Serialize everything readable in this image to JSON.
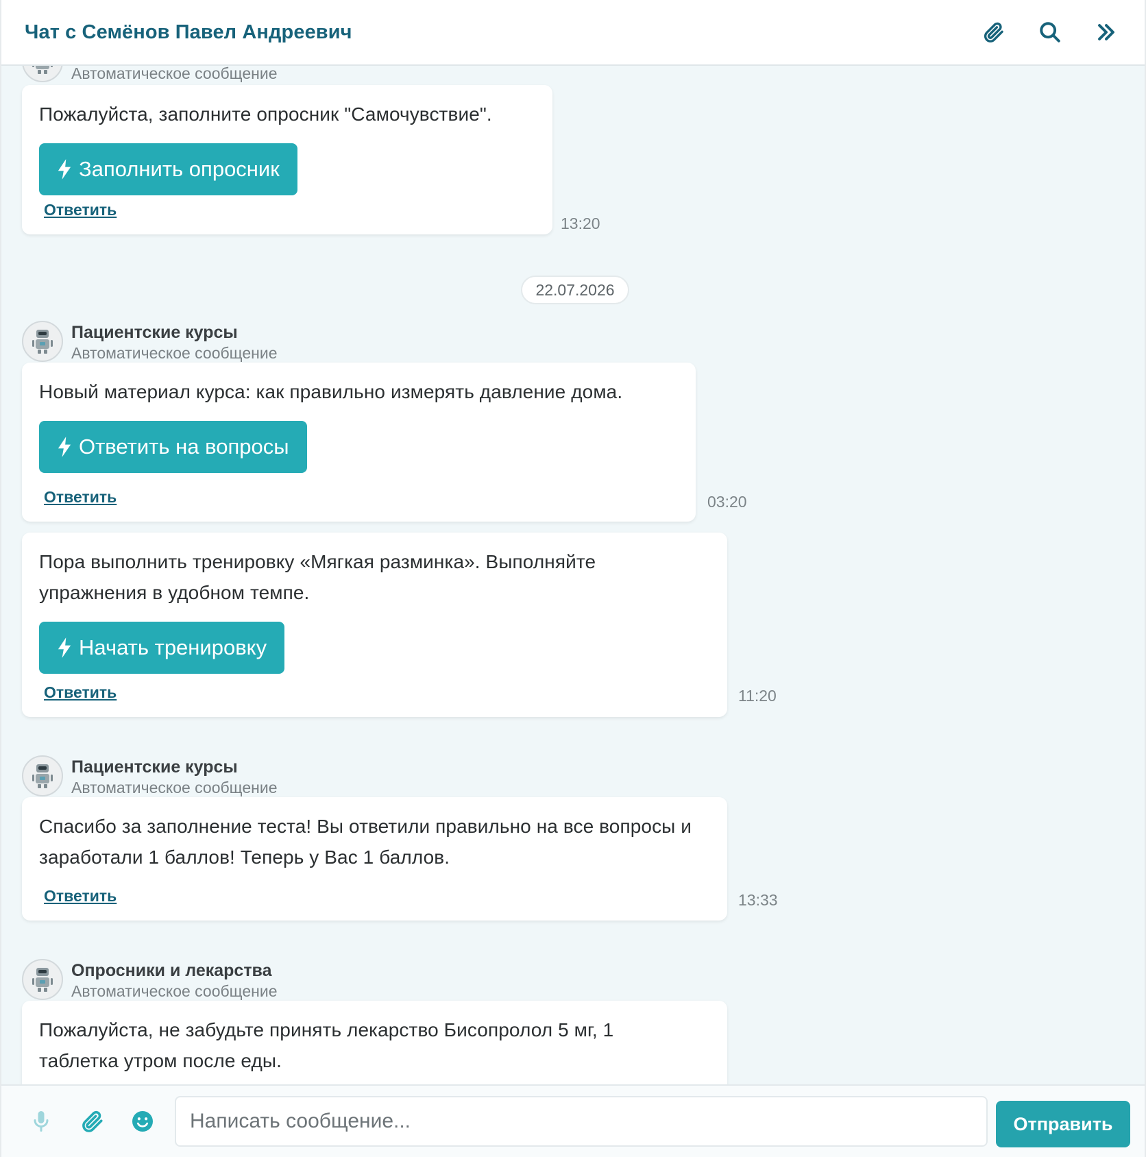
{
  "header": {
    "title": "Чат с Семёнов Павел Андреевич",
    "icons": [
      "paperclip-icon",
      "search-icon",
      "double-chevron-right-icon"
    ]
  },
  "colors": {
    "accent": "#25abb5",
    "title": "#17627a",
    "chat_bg": "#f0f7f9"
  },
  "chat": {
    "messages": [
      {
        "sender_sub": "Автоматическое сообщение",
        "text": "Пожалуйста, заполните опросник \"Самочувствие\".",
        "button": "Заполнить опросник",
        "reply": "Ответить",
        "time": "13:20"
      }
    ],
    "date_separator": "22.07.2026",
    "groups": [
      {
        "sender_name": "Пациентские курсы",
        "sender_sub": "Автоматическое сообщение",
        "messages": [
          {
            "text": "Новый материал курса: как правильно измерять давление дома.",
            "button": "Ответить на вопросы",
            "reply": "Ответить",
            "time": "03:20"
          },
          {
            "text": "Пора выполнить тренировку «Мягкая разминка». Выполняйте упражнения в удобном темпе.",
            "button": "Начать тренировку",
            "reply": "Ответить",
            "time": "11:20"
          }
        ]
      },
      {
        "sender_name": "Пациентские курсы",
        "sender_sub": "Автоматическое сообщение",
        "messages": [
          {
            "text": "Спасибо за заполнение теста! Вы ответили правильно на все вопросы и заработали 1 баллов! Теперь у Вас 1 баллов.",
            "reply": "Ответить",
            "time": "13:33"
          }
        ]
      },
      {
        "sender_name": "Опросники и лекарства",
        "sender_sub": "Автоматическое сообщение",
        "messages": [
          {
            "text": "Пожалуйста, не забудьте принять лекарство Бисопролол 5 мг, 1 таблетка утром после еды."
          }
        ]
      }
    ]
  },
  "composer": {
    "placeholder": "Написать сообщение...",
    "send_label": "Отправить",
    "icons": [
      "microphone-icon",
      "paperclip-icon",
      "emoji-icon"
    ]
  }
}
